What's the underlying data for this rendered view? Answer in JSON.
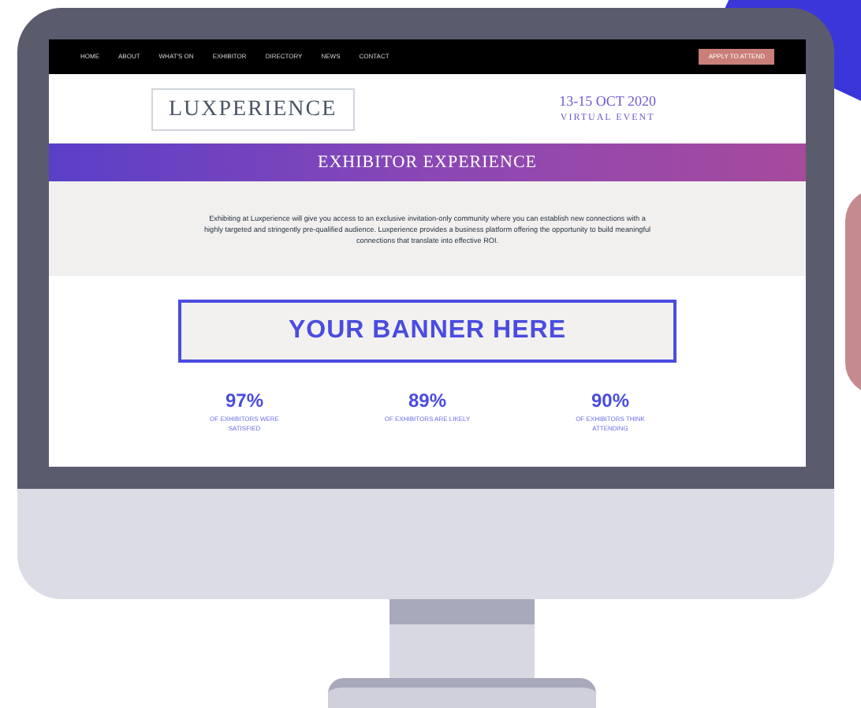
{
  "nav": {
    "items": [
      "HOME",
      "ABOUT",
      "WHAT'S ON",
      "EXHIBITOR",
      "DIRECTORY",
      "NEWS",
      "CONTACT"
    ],
    "button": "APPLY TO ATTEND"
  },
  "header": {
    "logo": "LUXPERIENCE",
    "dates": "13-15 OCT 2020",
    "event_type": "VIRTUAL EVENT"
  },
  "section": {
    "title": "EXHIBITOR EXPERIENCE",
    "text": "Exhibiting at Luxperience will give you access to an exclusive invitation-only community where you can establish new connections with a highly targeted and stringently pre-qualified audience. Luxperience provides a business platform offering the opportunity to build meaningful connections that translate into effective ROI."
  },
  "banner": "YOUR BANNER HERE",
  "stats": [
    {
      "value": "97%",
      "caption": "OF EXHIBITORS WERE SATISFIED"
    },
    {
      "value": "89%",
      "caption": "OF EXHIBITORS ARE LIKELY"
    },
    {
      "value": "90%",
      "caption": "OF EXHIBITORS THINK ATTENDING"
    }
  ]
}
